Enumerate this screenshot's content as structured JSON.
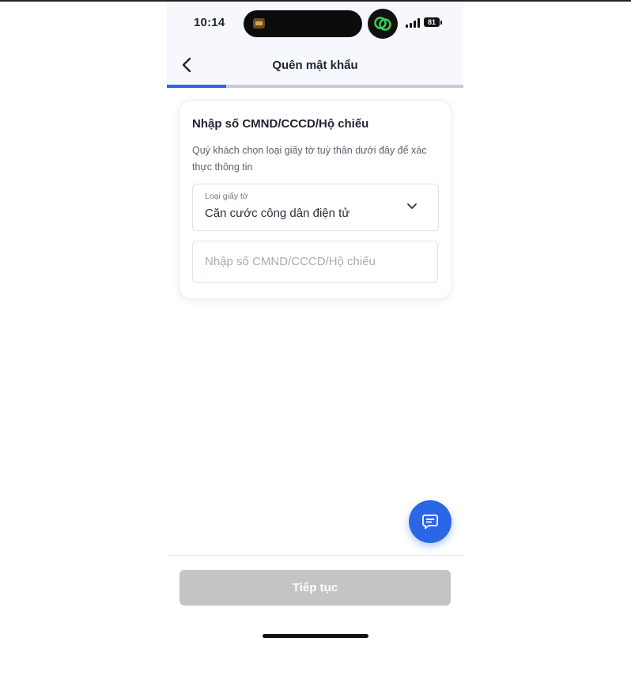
{
  "status_bar": {
    "time": "10:14",
    "battery": "81",
    "island_app_icon": "video-app-icon",
    "call_icon": "linked-rings-icon"
  },
  "header": {
    "back_icon": "chevron-left-icon",
    "title": "Quên mật khẩu"
  },
  "progress": {
    "step_fraction": 0.2,
    "fill_color": "#2a66e6",
    "track_color": "#c9ccd6"
  },
  "card": {
    "title": "Nhập số CMND/CCCD/Hộ chiếu",
    "description": "Quý khách chọn loại giấy tờ tuỳ thân dưới đây để xác thực thông tin",
    "document_type": {
      "label": "Loại giấy tờ",
      "value": "Căn cước công dân điện tử",
      "icon": "chevron-down-icon"
    },
    "id_number": {
      "value": "",
      "placeholder": "Nhập số CMND/CCCD/Hộ chiếu"
    }
  },
  "fab": {
    "icon": "chat-icon",
    "color": "#2a66e6"
  },
  "footer": {
    "continue_label": "Tiếp tục",
    "disabled_color": "#c4c4c4"
  }
}
